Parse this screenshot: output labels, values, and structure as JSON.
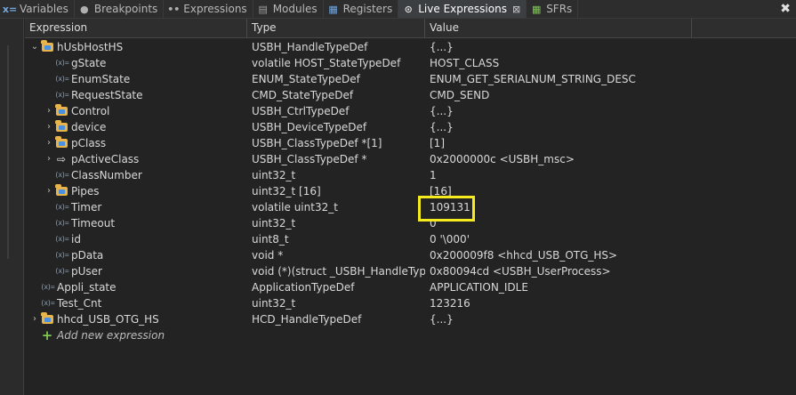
{
  "tabs": [
    {
      "label": "Variables",
      "icon": "variables-icon",
      "active": false
    },
    {
      "label": "Breakpoints",
      "icon": "breakpoints-icon",
      "active": false
    },
    {
      "label": "Expressions",
      "icon": "expressions-icon",
      "active": false
    },
    {
      "label": "Modules",
      "icon": "modules-icon",
      "active": false
    },
    {
      "label": "Registers",
      "icon": "registers-icon",
      "active": false
    },
    {
      "label": "Live Expressions",
      "icon": "live-expressions-icon",
      "active": true
    },
    {
      "label": "SFRs",
      "icon": "sfrs-icon",
      "active": false
    }
  ],
  "header": {
    "expression": "Expression",
    "type": "Type",
    "value": "Value"
  },
  "rows": [
    {
      "name": "hUsbHostHS",
      "type": "USBH_HandleTypeDef",
      "value": "{...}",
      "indent": 0,
      "twist": "expanded",
      "icon": "struct"
    },
    {
      "name": "gState",
      "type": "volatile HOST_StateTypeDef",
      "value": "HOST_CLASS",
      "indent": 1,
      "twist": "none",
      "icon": "var"
    },
    {
      "name": "EnumState",
      "type": "ENUM_StateTypeDef",
      "value": "ENUM_GET_SERIALNUM_STRING_DESC",
      "indent": 1,
      "twist": "none",
      "icon": "var"
    },
    {
      "name": "RequestState",
      "type": "CMD_StateTypeDef",
      "value": "CMD_SEND",
      "indent": 1,
      "twist": "none",
      "icon": "var"
    },
    {
      "name": "Control",
      "type": "USBH_CtrlTypeDef",
      "value": "{...}",
      "indent": 1,
      "twist": "collapsed",
      "icon": "struct"
    },
    {
      "name": "device",
      "type": "USBH_DeviceTypeDef",
      "value": "{...}",
      "indent": 1,
      "twist": "collapsed",
      "icon": "struct"
    },
    {
      "name": "pClass",
      "type": "USBH_ClassTypeDef *[1]",
      "value": "[1]",
      "indent": 1,
      "twist": "collapsed",
      "icon": "struct"
    },
    {
      "name": "pActiveClass",
      "type": "USBH_ClassTypeDef *",
      "value": "0x2000000c <USBH_msc>",
      "indent": 1,
      "twist": "collapsed",
      "icon": "pointer"
    },
    {
      "name": "ClassNumber",
      "type": "uint32_t",
      "value": "1",
      "indent": 1,
      "twist": "none",
      "icon": "var"
    },
    {
      "name": "Pipes",
      "type": "uint32_t [16]",
      "value": "[16]",
      "indent": 1,
      "twist": "collapsed",
      "icon": "struct"
    },
    {
      "name": "Timer",
      "type": "volatile uint32_t",
      "value": "109131",
      "indent": 1,
      "twist": "none",
      "icon": "var"
    },
    {
      "name": "Timeout",
      "type": "uint32_t",
      "value": "0",
      "indent": 1,
      "twist": "none",
      "icon": "var"
    },
    {
      "name": "id",
      "type": "uint8_t",
      "value": "0 '\\000'",
      "indent": 1,
      "twist": "none",
      "icon": "var"
    },
    {
      "name": "pData",
      "type": "void *",
      "value": "0x200009f8 <hhcd_USB_OTG_HS>",
      "indent": 1,
      "twist": "none",
      "icon": "var"
    },
    {
      "name": "pUser",
      "type": "void (*)(struct _USBH_HandleType...",
      "value": "0x80094cd <USBH_UserProcess>",
      "indent": 1,
      "twist": "none",
      "icon": "var"
    },
    {
      "name": "Appli_state",
      "type": "ApplicationTypeDef",
      "value": "APPLICATION_IDLE",
      "indent": 0,
      "twist": "none",
      "icon": "var"
    },
    {
      "name": "Test_Cnt",
      "type": "uint32_t",
      "value": "123216",
      "indent": 0,
      "twist": "none",
      "icon": "var"
    },
    {
      "name": "hhcd_USB_OTG_HS",
      "type": "HCD_HandleTypeDef",
      "value": "{...}",
      "indent": 0,
      "twist": "collapsed",
      "icon": "struct"
    }
  ],
  "add_expression": "Add new expression",
  "highlight_value": "109131"
}
